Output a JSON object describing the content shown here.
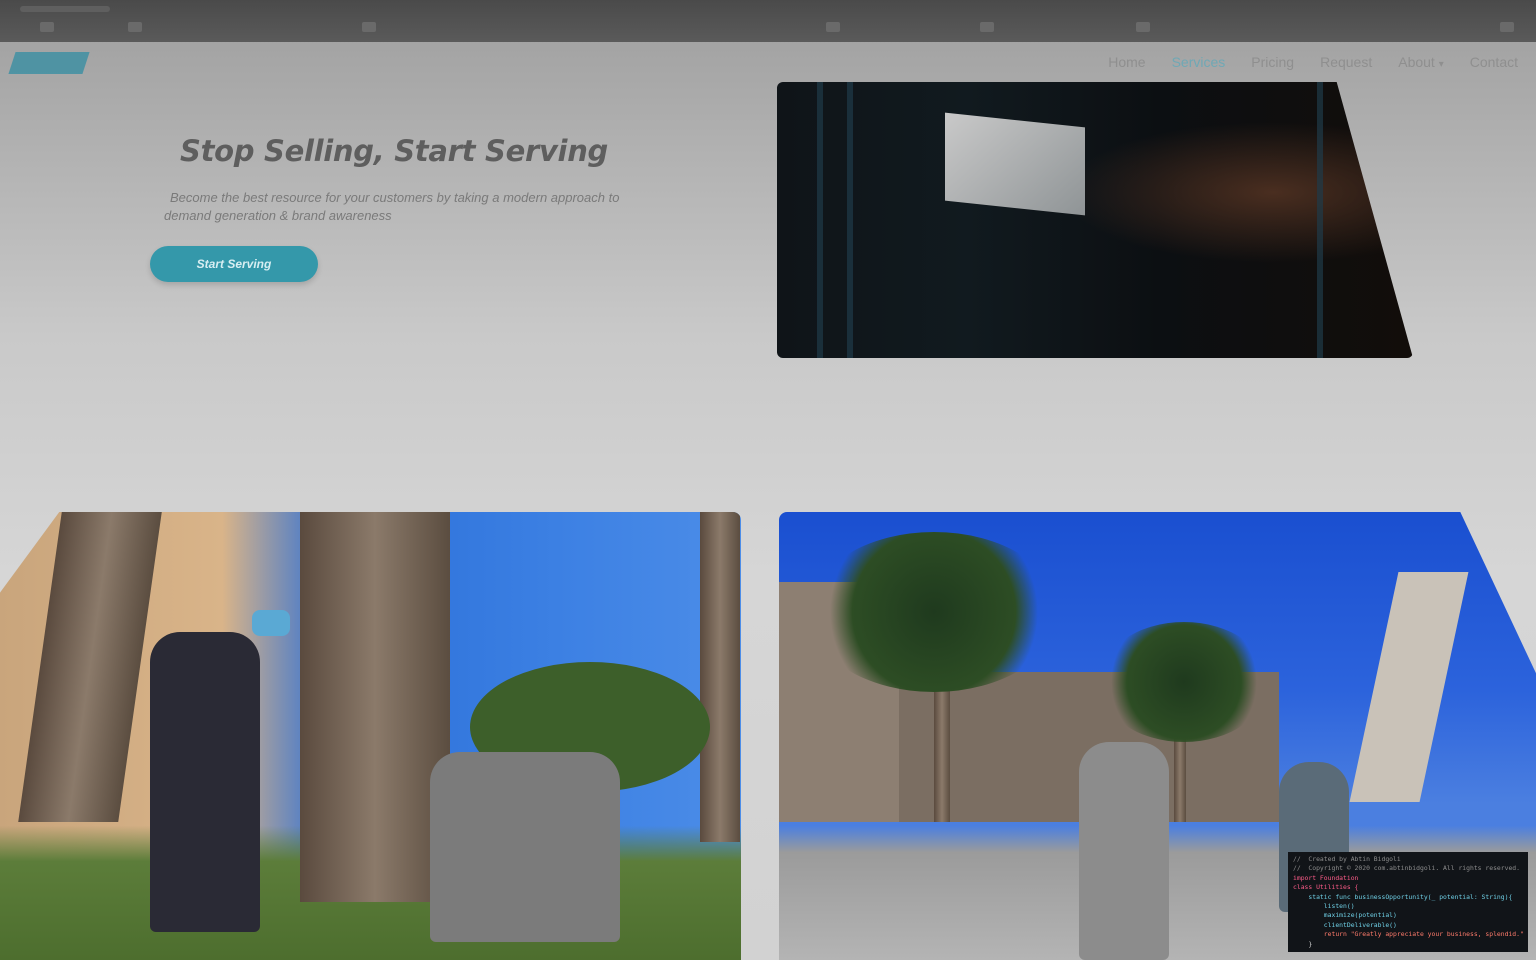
{
  "nav": {
    "items": [
      "Home",
      "Services",
      "Pricing",
      "Request",
      "About",
      "Contact"
    ],
    "active": "Services",
    "about_caret": "▾"
  },
  "hero": {
    "title": "Stop Selling, Start Serving",
    "subtitle": "Become the best resource for your customers by taking a modern approach to demand generation & brand awareness",
    "cta_label": "Start Serving"
  },
  "code_snippet": {
    "lines": [
      {
        "cls": "c",
        "text": "//  Created by Abtin Bidgoli"
      },
      {
        "cls": "c",
        "text": "//  Copyright © 2020 com.abtinbidgoli. All rights reserved."
      },
      {
        "cls": "k",
        "text": "import Foundation"
      },
      {
        "cls": "k",
        "text": "class Utilities {"
      },
      {
        "cls": "f",
        "text": "    static func businessOpportunity(_ potential: String){"
      },
      {
        "cls": "f",
        "text": "        listen()"
      },
      {
        "cls": "f",
        "text": "        maximize(potential)"
      },
      {
        "cls": "f",
        "text": "        clientDeliverable()"
      },
      {
        "cls": "s",
        "text": "        return \"Greatly appreciate your business, splendid.\""
      },
      {
        "cls": "",
        "text": "    }"
      }
    ]
  },
  "colors": {
    "accent": "#3498aa",
    "active_nav": "#6fa8b5"
  }
}
